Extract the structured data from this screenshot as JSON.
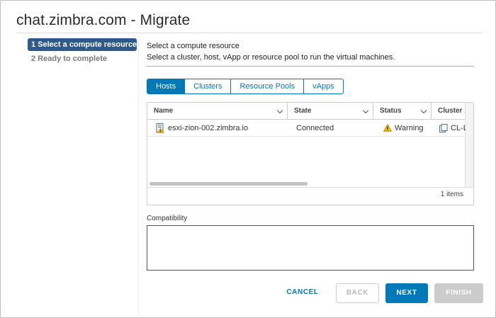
{
  "dialog": {
    "title": "chat.zimbra.com - Migrate"
  },
  "steps": [
    {
      "label": "1 Select a compute resource",
      "active": true
    },
    {
      "label": "2 Ready to complete",
      "active": false
    }
  ],
  "content": {
    "heading": "Select a compute resource",
    "subheading": "Select a cluster, host, vApp or resource pool to run the virtual machines."
  },
  "tabs": [
    {
      "label": "Hosts",
      "active": true
    },
    {
      "label": "Clusters",
      "active": false
    },
    {
      "label": "Resource Pools",
      "active": false
    },
    {
      "label": "vApps",
      "active": false
    }
  ],
  "grid": {
    "columns": [
      "Name",
      "State",
      "Status",
      "Cluster"
    ],
    "rows": [
      {
        "name": "esxi-zion-002.zimbra.io",
        "name_icon": "host-warning-icon",
        "state": "Connected",
        "status": "Warning",
        "status_icon": "warning-icon",
        "cluster": "CL-L",
        "cluster_icon": "cluster-icon"
      }
    ],
    "count": "1 items"
  },
  "compatibility": {
    "label": "Compatibility"
  },
  "buttons": {
    "cancel": "CANCEL",
    "back": "BACK",
    "next": "NEXT",
    "finish": "FINISH"
  },
  "colors": {
    "accent": "#0079b8",
    "step_active": "#2d5a8a",
    "warning": "#f5b800"
  }
}
